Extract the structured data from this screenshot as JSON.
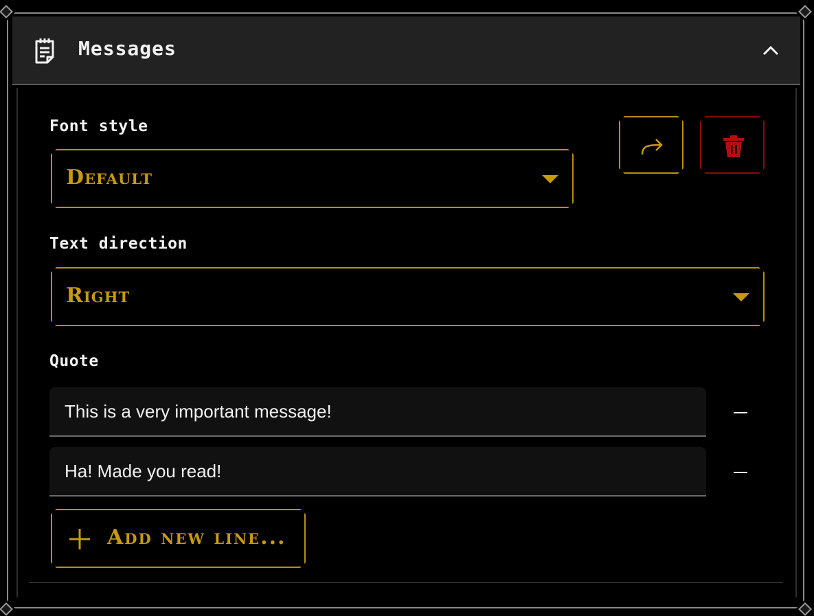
{
  "header": {
    "title": "Messages",
    "icon": "notepad-icon",
    "collapse_icon": "chevron-up-icon"
  },
  "font_style": {
    "label": "Font style",
    "value": "Default"
  },
  "actions": {
    "share_icon": "share-arrow-icon",
    "delete_icon": "trash-icon"
  },
  "text_direction": {
    "label": "Text direction",
    "value": "Right"
  },
  "quote": {
    "label": "Quote",
    "lines": [
      "This is a very important message!",
      "Ha! Made you read!"
    ]
  },
  "add_line": {
    "label": "Add new line..."
  },
  "colors": {
    "accent": "#c79a10",
    "danger": "#b20f0f",
    "panel_border": "#8a8a8a",
    "header_bg": "#222222"
  }
}
